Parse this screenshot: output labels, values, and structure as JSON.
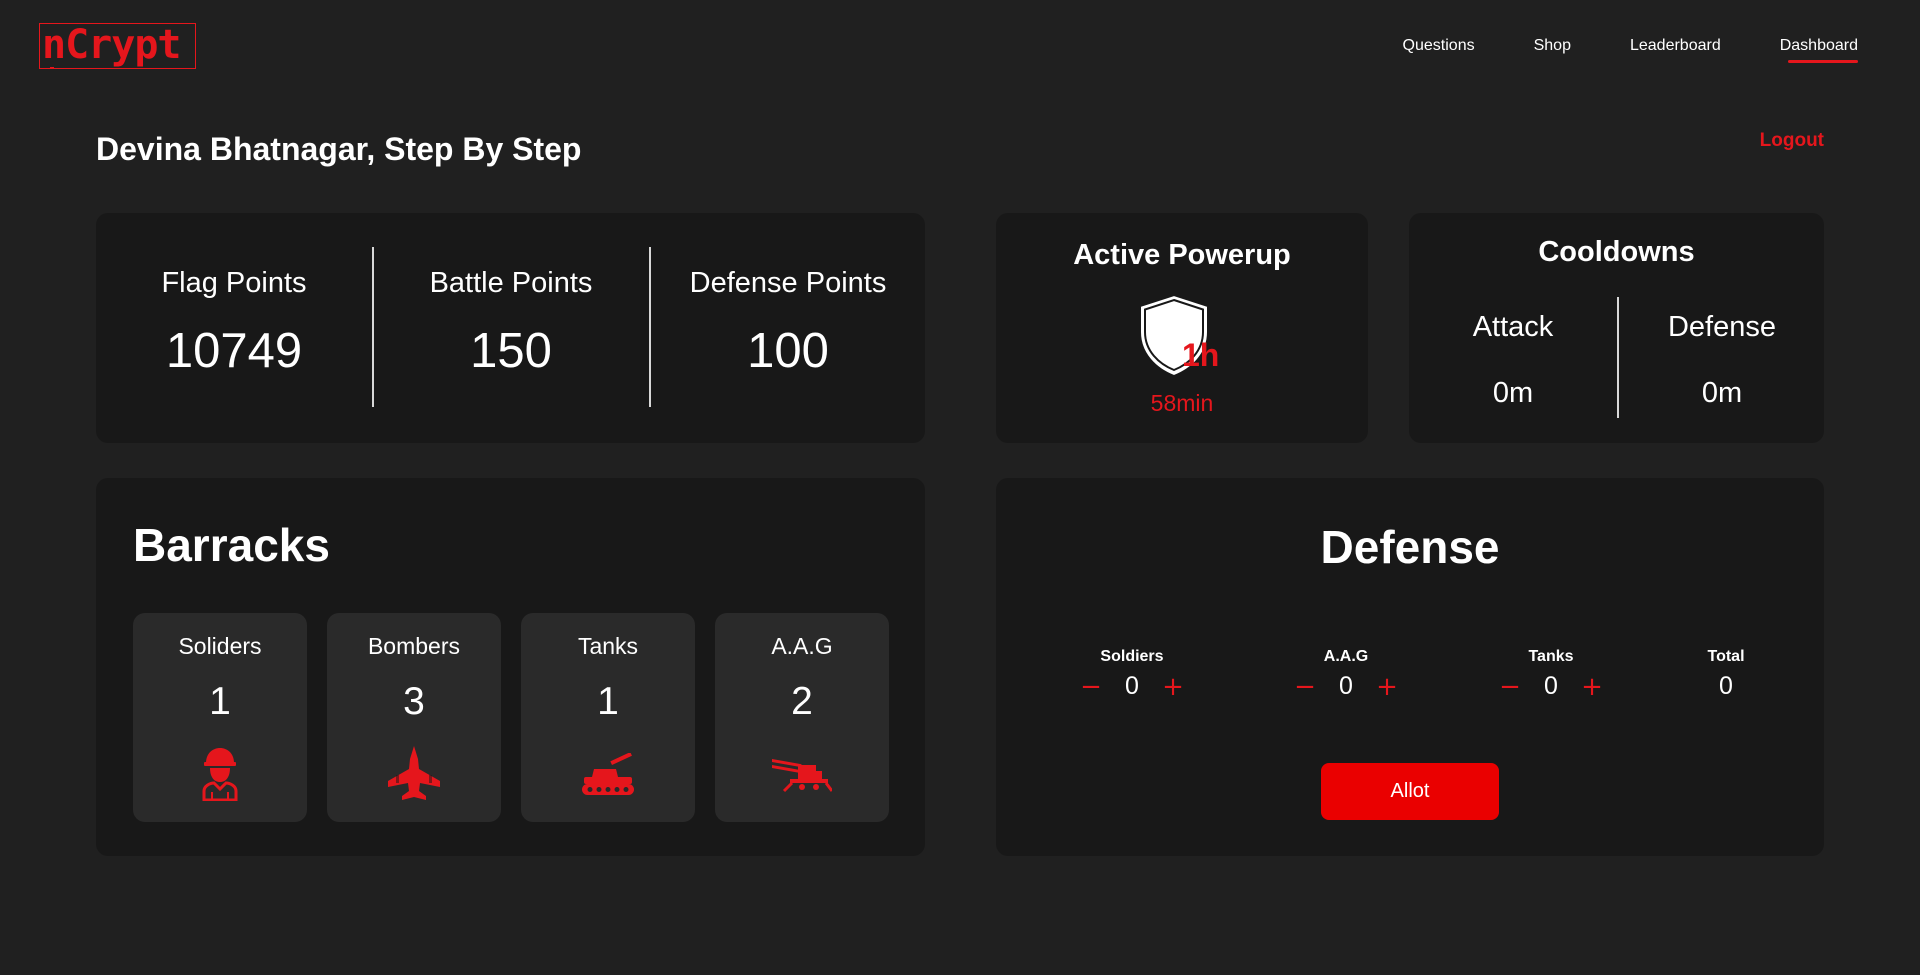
{
  "nav": {
    "logo_text": "nCrypt",
    "links": [
      {
        "label": "Questions"
      },
      {
        "label": "Shop"
      },
      {
        "label": "Leaderboard"
      },
      {
        "label": "Dashboard",
        "active": true
      }
    ]
  },
  "header": {
    "team_name": "Devina Bhatnagar, Step By Step",
    "logout_label": "Logout"
  },
  "points": [
    {
      "label": "Flag Points",
      "value": "10749"
    },
    {
      "label": "Battle Points",
      "value": "150"
    },
    {
      "label": "Defense Points",
      "value": "100"
    }
  ],
  "powerup": {
    "title": "Active Powerup",
    "icon": "shield-icon",
    "hours": "1h",
    "minutes": "58min"
  },
  "cooldowns": {
    "title": "Cooldowns",
    "attack": {
      "label": "Attack",
      "value": "0m"
    },
    "defense": {
      "label": "Defense",
      "value": "0m"
    }
  },
  "barracks": {
    "title": "Barracks",
    "units": [
      {
        "label": "Soliders",
        "count": "1",
        "icon": "soldier-icon"
      },
      {
        "label": "Bombers",
        "count": "3",
        "icon": "bomber-jet-icon"
      },
      {
        "label": "Tanks",
        "count": "1",
        "icon": "tank-icon"
      },
      {
        "label": "A.A.G",
        "count": "2",
        "icon": "anti-aircraft-gun-icon"
      }
    ]
  },
  "defense": {
    "title": "Defense",
    "minus_symbol": "−",
    "plus_symbol": "+",
    "allocations": [
      {
        "label": "Soldiers",
        "value": "0"
      },
      {
        "label": "A.A.G",
        "value": "0"
      },
      {
        "label": "Tanks",
        "value": "0"
      }
    ],
    "total": {
      "label": "Total",
      "value": "0"
    },
    "allot_label": "Allot"
  },
  "colors": {
    "accent": "#e5161c",
    "background": "#202020",
    "card": "#181818",
    "tile": "#2a2a2a",
    "button": "#ea0000"
  }
}
